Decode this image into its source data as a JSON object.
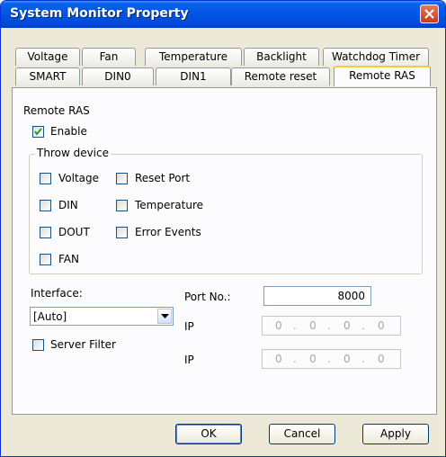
{
  "window": {
    "title": "System Monitor Property"
  },
  "tabs_row1": [
    "Voltage",
    "Fan",
    "Temperature",
    "Backlight",
    "Watchdog Timer"
  ],
  "tabs_row2": [
    "SMART",
    "DIN0",
    "DIN1",
    "Remote reset",
    "Remote RAS"
  ],
  "active_tab": "Remote RAS",
  "section": {
    "title": "Remote RAS",
    "enable": {
      "label": "Enable",
      "checked": true
    }
  },
  "throw_device": {
    "title": "Throw device",
    "items": [
      {
        "label": "Voltage",
        "checked": false
      },
      {
        "label": "Reset Port",
        "checked": false
      },
      {
        "label": "DIN",
        "checked": false
      },
      {
        "label": "Temperature",
        "checked": false
      },
      {
        "label": "DOUT",
        "checked": false
      },
      {
        "label": "Error Events",
        "checked": false
      },
      {
        "label": "FAN",
        "checked": false
      }
    ]
  },
  "interface": {
    "label": "Interface:",
    "value": "[Auto]"
  },
  "server_filter": {
    "label": "Server Filter",
    "checked": false
  },
  "port": {
    "label": "Port No.:",
    "value": "8000"
  },
  "ip1": {
    "label": "IP",
    "octets": [
      "0",
      "0",
      "0",
      "0"
    ],
    "dot": "."
  },
  "ip2": {
    "label": "IP",
    "octets": [
      "0",
      "0",
      "0",
      "0"
    ],
    "dot": "."
  },
  "buttons": {
    "ok": "OK",
    "cancel": "Cancel",
    "apply": "Apply"
  }
}
